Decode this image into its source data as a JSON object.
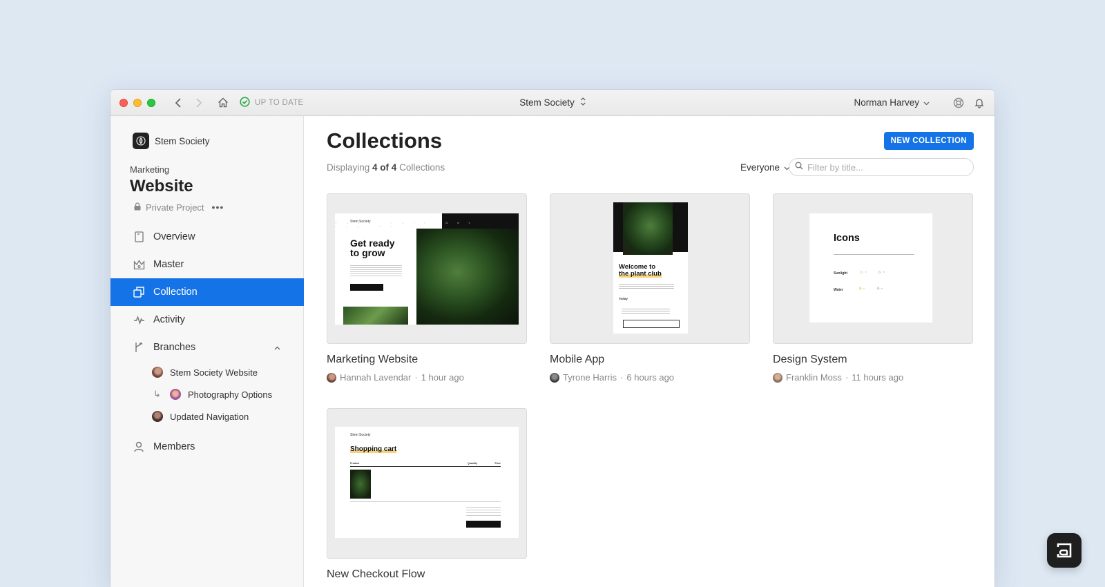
{
  "window": {
    "status_text": "UP TO DATE",
    "project_switcher": "Stem Society",
    "user_name": "Norman Harvey"
  },
  "sidebar": {
    "org_name": "Stem Society",
    "project_group": "Marketing",
    "project_title": "Website",
    "privacy": "Private Project",
    "more": "•••",
    "items": [
      {
        "label": "Overview",
        "icon": "document-icon"
      },
      {
        "label": "Master",
        "icon": "crown-icon"
      },
      {
        "label": "Collection",
        "icon": "collection-icon",
        "active": true
      },
      {
        "label": "Activity",
        "icon": "activity-icon"
      },
      {
        "label": "Branches",
        "icon": "branch-icon",
        "expanded": true
      },
      {
        "label": "Members",
        "icon": "person-icon"
      }
    ],
    "branches": [
      {
        "label": "Stem Society Website"
      },
      {
        "label": "Photography Options",
        "nested": true
      },
      {
        "label": "Updated Navigation"
      }
    ]
  },
  "main": {
    "title": "Collections",
    "new_button": "NEW COLLECTION",
    "count_prefix": "Displaying",
    "count_shown": "4 of 4",
    "count_suffix": "Collections",
    "owner_filter": "Everyone",
    "search_placeholder": "Filter by title...",
    "cards": [
      {
        "title": "Marketing Website",
        "author": "Hannah Lavendar",
        "time": "1 hour ago"
      },
      {
        "title": "Mobile App",
        "author": "Tyrone Harris",
        "time": "6 hours ago"
      },
      {
        "title": "Design System",
        "author": "Franklin Moss",
        "time": "11 hours ago"
      },
      {
        "title": "New Checkout Flow"
      }
    ],
    "thumbs": {
      "marketing": {
        "brand": "Stem Society",
        "nav": "Shop Care Get app Cart",
        "heading": "Get ready to grow"
      },
      "mobile": {
        "heading_1": "Welcome to",
        "heading_2": "the plant club",
        "today": "Today"
      },
      "design": {
        "heading": "Icons",
        "row_1": "Sunlight",
        "row_2": "Water"
      },
      "checkout": {
        "brand": "Stem Society",
        "heading": "Shopping cart",
        "col_product": "Product",
        "col_qty": "Quantity",
        "col_price": "Price"
      }
    }
  },
  "colors": {
    "accent": "#1473e6",
    "background": "#dde8f3"
  }
}
